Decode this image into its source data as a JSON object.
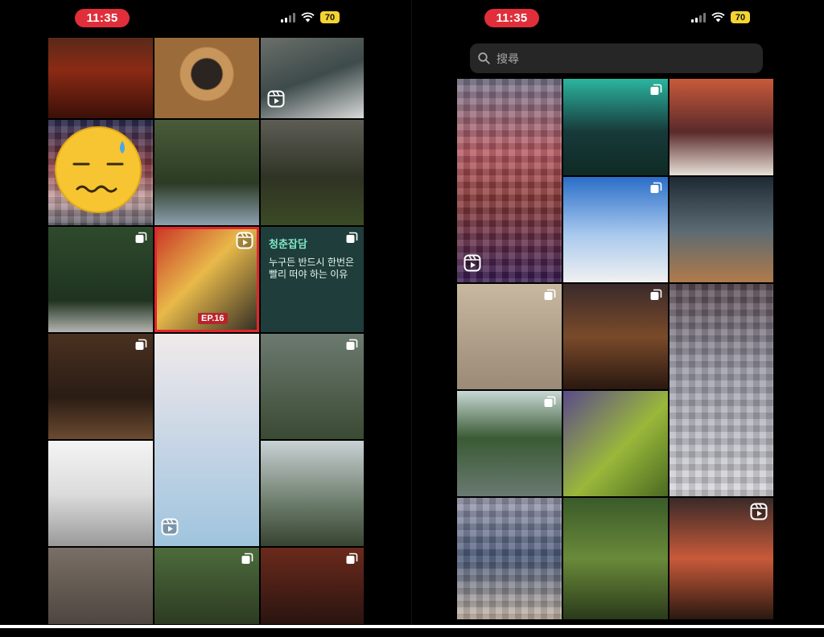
{
  "left_panel": {
    "status_bar": {
      "time": "11:35",
      "battery": "70"
    }
  },
  "right_panel": {
    "status_bar": {
      "time": "11:35",
      "battery": "70"
    },
    "search": {
      "placeholder": "搜尋"
    }
  },
  "left_tiles": [
    {
      "name": "lava-photo",
      "bg": "linear-gradient(180deg,#5a2a18 0%,#8b2a15 40%,#3b1008 100%)"
    },
    {
      "name": "crater-photo",
      "bg": "radial-gradient(circle at 50% 45%,#2b2420 0 22%,#c8955a 24% 38%,#9b6b3a 40% 100%)"
    },
    {
      "name": "trash-bag-reel",
      "bg": "linear-gradient(160deg,#6b6f6a 0%,#3d4b4a 50%,#d9d9d9 100%)",
      "badge": "reel-icon",
      "badge_pos": "bottom-left"
    },
    {
      "name": "blurred-person-photo",
      "bg": "linear-gradient(180deg,#2b2e55 0%,#8a3a40 45%,#c9a3a4 75%,#5a5a66 100%)",
      "pixel": true
    },
    {
      "name": "man-in-forest-photo",
      "bg": "linear-gradient(180deg,#4a5b3a 0%,#2c3b24 60%,#8ca0b0 100%)"
    },
    {
      "name": "daffodil-photo",
      "bg": "linear-gradient(180deg,#5d5d55 0%,#2f3324 55%,#3b4a25 100%)"
    },
    {
      "name": "frame-on-wall-carousel",
      "bg": "linear-gradient(180deg,#2e4a2c 0%,#1f3320 70%,#b4b4b0 100%)",
      "badge": "carousel-icon"
    },
    {
      "name": "comic-reel",
      "bg": "linear-gradient(135deg,#c93326 0%,#e8b94a 45%,#2e2a24 100%)",
      "badge": "reel-icon",
      "label": "EP.16",
      "highlight": true
    },
    {
      "name": "korean-text-carousel",
      "bg": "#1f3d3a",
      "badge": "carousel-icon",
      "title": "청춘잡담",
      "text": "누구든 반드시 한번은 빨리 떠야 하는 이유"
    },
    {
      "name": "interior-carousel",
      "bg": "linear-gradient(180deg,#4a3120 0%,#2a1c14 60%,#6b4a30 100%)",
      "badge": "carousel-icon"
    },
    {
      "name": "selfie-reel",
      "bg": "linear-gradient(180deg,#f0eaea 0%,#c8d6e6 50%,#9fc4de 100%)",
      "badge": "reel-icon",
      "badge_pos": "bottom-left",
      "span_rows": 2
    },
    {
      "name": "valley-carousel",
      "bg": "linear-gradient(180deg,#6c7a70 0%,#3a4a33 100%)",
      "badge": "carousel-icon"
    },
    {
      "name": "white-room-photo",
      "bg": "linear-gradient(180deg,#f4f4f4 0%,#dcdcdc 50%,#9a9a9a 100%)"
    },
    {
      "name": "hiker-photo",
      "bg": "linear-gradient(180deg,#c9d1d4 0%,#6b7b6a 60%,#384432 100%)"
    },
    {
      "name": "room-corner-photo",
      "bg": "linear-gradient(180deg,#7a6f66 0%,#4e4640 100%)"
    },
    {
      "name": "dog-running-carousel",
      "bg": "linear-gradient(180deg,#4c6b3c 0%,#2d3b22 100%)",
      "badge": "carousel-icon"
    },
    {
      "name": "man-portrait-carousel",
      "bg": "linear-gradient(180deg,#6b2a1c 0%,#2a1410 100%)",
      "badge": "carousel-icon"
    }
  ],
  "right_tiles": [
    {
      "name": "blurred-person-reel",
      "bg": "linear-gradient(180deg,#7a7890 0%,#b85a63 35%,#8a3a38 60%,#3a1d55 100%)",
      "pixel": true,
      "span_rows": 2,
      "badge": "reel-icon",
      "badge_pos": "bottom-left"
    },
    {
      "name": "city-robot-carousel",
      "bg": "linear-gradient(180deg,#2bb5a0 0%,#173a3a 55%,#0f2a24 100%)",
      "badge": "carousel-icon"
    },
    {
      "name": "boat-sunset-photo",
      "bg": "linear-gradient(180deg,#c85a3a 0%,#5a2a2a 55%,#e8e0d8 100%)"
    },
    {
      "name": "sky-building-carousel",
      "bg": "linear-gradient(180deg,#2a6ec8 0%,#a9c9ee 55%,#f0f0f0 100%)",
      "badge": "carousel-icon"
    },
    {
      "name": "mall-interior-photo",
      "bg": "linear-gradient(180deg,#1e2a33 0%,#5a6a72 50%,#b07a4a 100%)"
    },
    {
      "name": "gallery-carousel",
      "bg": "linear-gradient(180deg,#c8b8a0 0%,#9a8a76 100%)",
      "badge": "carousel-icon"
    },
    {
      "name": "city-street-carousel",
      "bg": "linear-gradient(180deg,#3a2a2a 0%,#7a4a2a 50%,#2a1810 100%)",
      "badge": "carousel-icon"
    },
    {
      "name": "blurred-monkey-photo",
      "bg": "linear-gradient(180deg,#5a4a55 0%,#9a9aa6 40%,#d8d8de 100%)",
      "pixel": true,
      "span_rows": 2
    },
    {
      "name": "dog-in-water-carousel",
      "bg": "linear-gradient(180deg,#c8d8d4 0%,#3a5a34 45%,#6a7a72 100%)",
      "badge": "carousel-icon"
    },
    {
      "name": "grass-photo",
      "bg": "linear-gradient(135deg,#5a4a8a 0%,#9ab83a 55%,#4a6a22 100%)"
    },
    {
      "name": "blurred-people-photo",
      "bg": "linear-gradient(180deg,#9a9ab0 0%,#4a5a7a 50%,#c8b8a8 100%)",
      "pixel": true
    },
    {
      "name": "forest-photo",
      "bg": "linear-gradient(180deg,#3a5a2a 0%,#6a8a3a 50%,#2a3a1a 100%)"
    },
    {
      "name": "orangutan-reel",
      "bg": "linear-gradient(180deg,#3a2a28 0%,#c85a3a 50%,#2a1810 100%)",
      "badge": "reel-icon"
    }
  ]
}
